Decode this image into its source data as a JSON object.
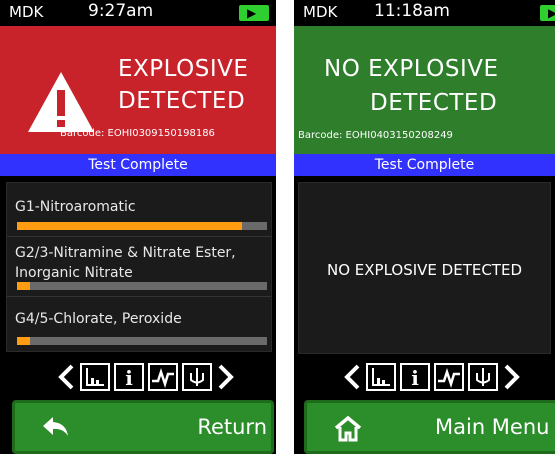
{
  "left_screen": {
    "status": {
      "device": "MDK",
      "time": "9:27am"
    },
    "banner": {
      "line1": "EXPLOSIVE",
      "line2": "DETECTED",
      "barcode": "Barcode: EOHI0309150198186",
      "color": "#c8232b",
      "icon": "warning-triangle-icon"
    },
    "test_status": "Test Complete",
    "results": [
      {
        "label": "G1-Nitroaromatic",
        "level": 0.9
      },
      {
        "label": "G2/3-Nitramine & Nitrate Ester, Inorganic Nitrate",
        "level": 0.05
      },
      {
        "label": "G4/5-Chlorate, Peroxide",
        "level": 0.05
      }
    ],
    "action_button": {
      "label": "Return",
      "icon": "back-arrow-icon"
    }
  },
  "right_screen": {
    "status": {
      "device": "MDK",
      "time": "11:18am"
    },
    "banner": {
      "line1": "NO EXPLOSIVE",
      "line2": "DETECTED",
      "barcode": "Barcode: EOHI0403150208249",
      "color": "#2f7e2c"
    },
    "test_status": "Test Complete",
    "message": "NO EXPLOSIVE DETECTED",
    "action_button": {
      "label": "Main Menu",
      "icon": "home-icon"
    }
  },
  "toolbar_icons": [
    "prev-arrow-icon",
    "bar-chart-icon",
    "info-icon",
    "waveform-icon",
    "sample-icon",
    "next-arrow-icon"
  ],
  "colors": {
    "accent_orange": "#ff9c12",
    "status_blue": "#3232ff",
    "button_green": "#2c8e2a"
  }
}
